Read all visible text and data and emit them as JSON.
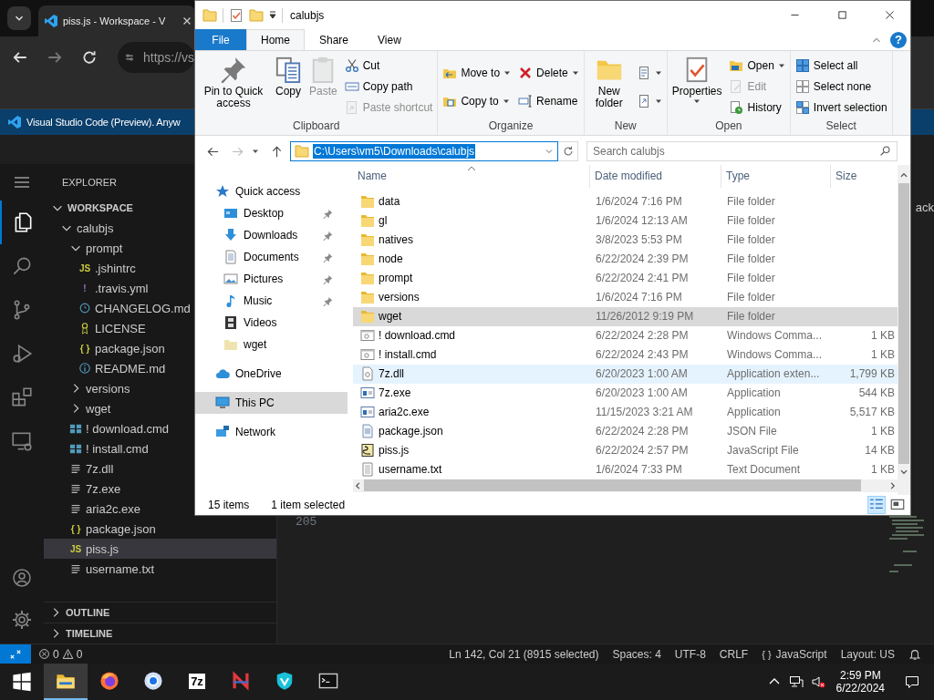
{
  "browser": {
    "tab_title": "piss.js - Workspace - V",
    "address": "https://vs",
    "banner": "Visual Studio Code (Preview). Anyw"
  },
  "vscode": {
    "activity": [
      {
        "kind": "files",
        "selected": true
      },
      {
        "kind": "search",
        "selected": false
      },
      {
        "kind": "source-control",
        "selected": false
      },
      {
        "kind": "run",
        "selected": false
      },
      {
        "kind": "extensions",
        "selected": false
      },
      {
        "kind": "remote",
        "selected": false
      }
    ],
    "sidebar_title": "EXPLORER",
    "tree": [
      {
        "label": "WORKSPACE",
        "kind": "section",
        "expanded": true,
        "selected": false,
        "children": [
          {
            "label": "calubjs",
            "kind": "folder",
            "expanded": true,
            "selected": false,
            "children": [
              {
                "label": "prompt",
                "kind": "folder",
                "expanded": true,
                "selected": false,
                "children": [
                  {
                    "label": ".jshintrc",
                    "kind": "js",
                    "icon_text": "JS",
                    "selected": false
                  },
                  {
                    "label": ".travis.yml",
                    "kind": "yaml",
                    "icon_text": "!",
                    "selected": false
                  },
                  {
                    "label": "CHANGELOG.md",
                    "kind": "changelog",
                    "selected": false
                  },
                  {
                    "label": "LICENSE",
                    "kind": "license",
                    "selected": false
                  },
                  {
                    "label": "package.json",
                    "kind": "json",
                    "icon_text": "{ }",
                    "selected": false
                  },
                  {
                    "label": "README.md",
                    "kind": "info",
                    "selected": false
                  }
                ]
              },
              {
                "label": "versions",
                "kind": "folder",
                "expanded": false,
                "selected": false
              },
              {
                "label": "wget",
                "kind": "folder",
                "expanded": false,
                "selected": false
              },
              {
                "label": "! download.cmd",
                "kind": "cmd",
                "selected": false
              },
              {
                "label": "! install.cmd",
                "kind": "cmd",
                "selected": false
              },
              {
                "label": "7z.dll",
                "kind": "text",
                "selected": false
              },
              {
                "label": "7z.exe",
                "kind": "text",
                "selected": false
              },
              {
                "label": "aria2c.exe",
                "kind": "text",
                "selected": false
              },
              {
                "label": "package.json",
                "kind": "json",
                "icon_text": "{ }",
                "selected": false
              },
              {
                "label": "piss.js",
                "kind": "js",
                "icon_text": "JS",
                "selected": true
              },
              {
                "label": "username.txt",
                "kind": "text",
                "selected": false
              }
            ]
          }
        ]
      }
    ],
    "panels": [
      {
        "label": "OUTLINE",
        "expanded": false
      },
      {
        "label": "TIMELINE",
        "expanded": false
      }
    ],
    "line_number": "205",
    "tab_fragment": "ack",
    "status": {
      "errors": "0",
      "warnings": "0",
      "items": [
        {
          "kind": "text",
          "text": "Ln 142, Col 21 (8915 selected)"
        },
        {
          "kind": "text",
          "text": "Spaces: 4"
        },
        {
          "kind": "text",
          "text": "UTF-8"
        },
        {
          "kind": "text",
          "text": "CRLF"
        },
        {
          "kind": "language",
          "icon_text": "{ }",
          "text": "JavaScript"
        },
        {
          "kind": "text",
          "text": "Layout: US"
        }
      ]
    }
  },
  "explorer": {
    "title": "calubjs",
    "help": "?",
    "tabs": [
      {
        "label": "File",
        "kind": "file",
        "selected": false
      },
      {
        "label": "Home",
        "kind": "tab",
        "selected": true
      },
      {
        "label": "Share",
        "kind": "tab",
        "selected": false
      },
      {
        "label": "View",
        "kind": "tab",
        "selected": false
      }
    ],
    "groups": [
      {
        "label": "Clipboard",
        "columns": [
          [
            {
              "label": "Pin to Quick access",
              "kind": "pin",
              "large": true,
              "disabled": false,
              "dropdown": false
            }
          ],
          [
            {
              "label": "Copy",
              "kind": "copy",
              "large": true,
              "disabled": false,
              "dropdown": false
            }
          ],
          [
            {
              "label": "Paste",
              "kind": "paste",
              "large": true,
              "disabled": true,
              "dropdown": false
            }
          ],
          [
            {
              "label": "Cut",
              "kind": "cut",
              "large": false,
              "disabled": false,
              "dropdown": false
            },
            {
              "label": "Copy path",
              "kind": "copypath",
              "large": false,
              "disabled": false,
              "dropdown": false
            },
            {
              "label": "Paste shortcut",
              "kind": "pasteshortcut",
              "large": false,
              "disabled": true,
              "dropdown": false
            }
          ]
        ]
      },
      {
        "label": "Organize",
        "columns": [
          [
            {
              "label": "Move to",
              "kind": "moveto",
              "large": false,
              "disabled": false,
              "dropdown": true
            },
            {
              "label": "Copy to",
              "kind": "copyto",
              "large": false,
              "disabled": false,
              "dropdown": true
            }
          ],
          [
            {
              "label": "Delete",
              "kind": "delete",
              "large": false,
              "disabled": false,
              "dropdown": true
            },
            {
              "label": "Rename",
              "kind": "rename",
              "large": false,
              "disabled": false,
              "dropdown": false
            }
          ]
        ]
      },
      {
        "label": "New",
        "columns": [
          [
            {
              "label": "New folder",
              "kind": "newfolder",
              "large": true,
              "disabled": false,
              "dropdown": false
            }
          ],
          [
            {
              "kind": "newitem",
              "large": false,
              "disabled": false,
              "dropdown": true
            },
            {
              "kind": "easyaccess",
              "large": false,
              "disabled": false,
              "dropdown": true
            }
          ]
        ]
      },
      {
        "label": "Open",
        "columns": [
          [
            {
              "label": "Properties",
              "kind": "properties",
              "large": true,
              "disabled": false,
              "dropdown": true
            }
          ],
          [
            {
              "label": "Open",
              "kind": "open",
              "large": false,
              "disabled": false,
              "dropdown": true
            },
            {
              "label": "Edit",
              "kind": "edit",
              "large": false,
              "disabled": true,
              "dropdown": false
            },
            {
              "label": "History",
              "kind": "history",
              "large": false,
              "disabled": false,
              "dropdown": false
            }
          ]
        ]
      },
      {
        "label": "Select",
        "columns": [
          [
            {
              "label": "Select all",
              "kind": "selectall",
              "large": false,
              "disabled": false,
              "dropdown": false
            },
            {
              "label": "Select none",
              "kind": "selectnone",
              "large": false,
              "disabled": false,
              "dropdown": false
            },
            {
              "label": "Invert selection",
              "kind": "invert",
              "large": false,
              "disabled": false,
              "dropdown": false
            }
          ]
        ]
      }
    ],
    "address": {
      "text": "C:\\Users\\vm5\\Downloads\\calubjs",
      "selected": true
    },
    "search_placeholder": "Search calubjs",
    "nav": [
      {
        "label": "Quick access",
        "kind": "star",
        "selected": false,
        "children": [
          {
            "label": "Desktop",
            "kind": "desktop",
            "pinned": true,
            "selected": false
          },
          {
            "label": "Downloads",
            "kind": "downloads",
            "pinned": true,
            "selected": false
          },
          {
            "label": "Documents",
            "kind": "documents",
            "pinned": true,
            "selected": false
          },
          {
            "label": "Pictures",
            "kind": "pictures",
            "pinned": true,
            "selected": false
          },
          {
            "label": "Music",
            "kind": "music",
            "pinned": true,
            "selected": false
          },
          {
            "label": "Videos",
            "kind": "videos",
            "pinned": false,
            "selected": false
          },
          {
            "label": "wget",
            "kind": "folder",
            "pinned": false,
            "selected": false
          }
        ]
      },
      {
        "label": "OneDrive",
        "kind": "cloud",
        "selected": false
      },
      {
        "label": "This PC",
        "kind": "pc",
        "selected": true
      },
      {
        "label": "Network",
        "kind": "network",
        "selected": false
      }
    ],
    "columns": [
      "Name",
      "Date modified",
      "Type",
      "Size"
    ],
    "files": [
      {
        "name": "data",
        "date": "1/6/2024 7:16 PM",
        "type": "File folder",
        "kind": "folder",
        "selected": false,
        "hovered": false
      },
      {
        "name": "gl",
        "date": "1/6/2024 12:13 AM",
        "type": "File folder",
        "kind": "folder",
        "selected": false,
        "hovered": false
      },
      {
        "name": "natives",
        "date": "3/8/2023 5:53 PM",
        "type": "File folder",
        "kind": "folder",
        "selected": false,
        "hovered": false
      },
      {
        "name": "node",
        "date": "6/22/2024 2:39 PM",
        "type": "File folder",
        "kind": "folder",
        "selected": false,
        "hovered": false
      },
      {
        "name": "prompt",
        "date": "6/22/2024 2:41 PM",
        "type": "File folder",
        "kind": "folder",
        "selected": false,
        "hovered": false
      },
      {
        "name": "versions",
        "date": "1/6/2024 7:16 PM",
        "type": "File folder",
        "kind": "folder",
        "selected": false,
        "hovered": false
      },
      {
        "name": "wget",
        "date": "11/26/2012 9:19 PM",
        "type": "File folder",
        "kind": "folder",
        "selected": true,
        "hovered": false
      },
      {
        "name": "! download.cmd",
        "date": "6/22/2024 2:28 PM",
        "type": "Windows Comma...",
        "size": "1 KB",
        "kind": "cmd",
        "selected": false,
        "hovered": false
      },
      {
        "name": "! install.cmd",
        "date": "6/22/2024 2:43 PM",
        "type": "Windows Comma...",
        "size": "1 KB",
        "kind": "cmd",
        "selected": false,
        "hovered": false
      },
      {
        "name": "7z.dll",
        "date": "6/20/2023 1:00 AM",
        "type": "Application exten...",
        "size": "1,799 KB",
        "kind": "dll",
        "selected": false,
        "hovered": true
      },
      {
        "name": "7z.exe",
        "date": "6/20/2023 1:00 AM",
        "type": "Application",
        "size": "544 KB",
        "kind": "exe",
        "selected": false,
        "hovered": false
      },
      {
        "name": "aria2c.exe",
        "date": "11/15/2023 3:21 AM",
        "type": "Application",
        "size": "5,517 KB",
        "kind": "exe",
        "selected": false,
        "hovered": false
      },
      {
        "name": "package.json",
        "date": "6/22/2024 2:28 PM",
        "type": "JSON File",
        "size": "1 KB",
        "kind": "json",
        "selected": false,
        "hovered": false
      },
      {
        "name": "piss.js",
        "date": "6/22/2024 2:57 PM",
        "type": "JavaScript File",
        "size": "14 KB",
        "kind": "js",
        "selected": false,
        "hovered": false
      },
      {
        "name": "username.txt",
        "date": "1/6/2024 7:33 PM",
        "type": "Text Document",
        "size": "1 KB",
        "kind": "txt",
        "selected": false,
        "hovered": false
      }
    ],
    "status": [
      "15 items",
      "1 item selected"
    ]
  },
  "taskbar": {
    "apps": [
      {
        "kind": "explorer",
        "selected": true
      },
      {
        "kind": "firefox",
        "selected": false
      },
      {
        "kind": "chrome",
        "selected": false
      },
      {
        "kind": "archiver",
        "label": "7z",
        "selected": false
      },
      {
        "kind": "zigzag",
        "selected": false
      },
      {
        "kind": "shield",
        "selected": false
      },
      {
        "kind": "terminal",
        "selected": false
      }
    ],
    "time": "2:59 PM",
    "date": "6/22/2024"
  }
}
